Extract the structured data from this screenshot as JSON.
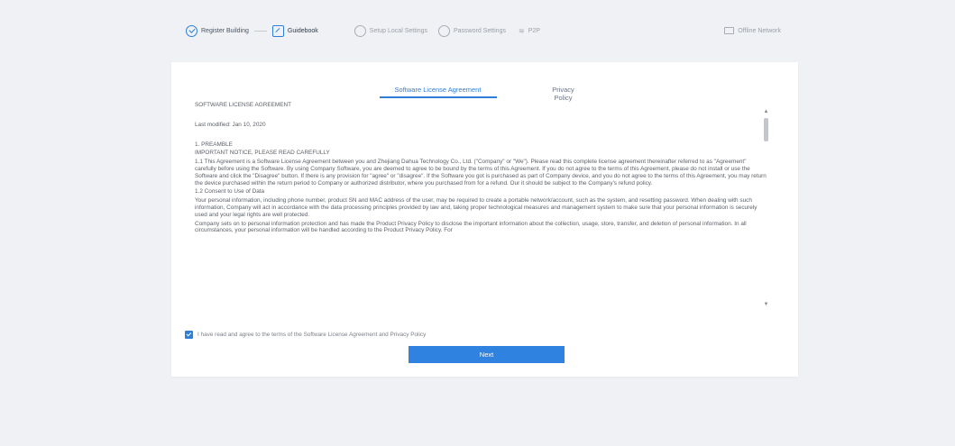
{
  "steps": [
    {
      "label": "Register Building",
      "state": "done",
      "icon": "check-circle-icon"
    },
    {
      "label": "Guidebook",
      "state": "active",
      "icon": "edit-icon"
    },
    {
      "label": "Setup Local Settings",
      "state": "pending",
      "icon": "circle-icon"
    },
    {
      "label": "Password Settings",
      "state": "pending",
      "icon": "circle-icon"
    },
    {
      "label": "P2P",
      "state": "pending",
      "icon": "wifi-icon"
    },
    {
      "label": "Offline Network",
      "state": "pending",
      "icon": "offline-icon"
    }
  ],
  "tabs": {
    "license": "Software License Agreement",
    "privacy": "Privacy Policy"
  },
  "document": {
    "title": "SOFTWARE LICENSE AGREEMENT",
    "modified": "Last modified: Jan 10, 2020",
    "section1": "1. PREAMBLE",
    "notice": "IMPORTANT NOTICE, PLEASE READ CAREFULLY",
    "p1": "1.1 This Agreement is a Software License Agreement between you and Zhejiang Dahua Technology Co., Ltd. (\"Company\" or \"We\"). Please read this complete license agreement thereinafter referred to as \"Agreement\" carefully before using the Software. By using Company Software, you are deemed to agree to be bound by the terms of this Agreement. If you do not agree to the terms of this Agreement, please do not install or use the Software and click the \"Disagree\" button. If there is any provision for \"agree\" or \"disagree\". If the Software you got is purchased as part of Company device, and you do not agree to the terms of this Agreement, you may return the device purchased within the return period to Company or authorized distributor, where you purchased from for a refund. Our it should be subject to the Company's refund policy.",
    "p2title": "1.2 Consent to Use of Data",
    "p2": "Your personal information, including phone number, product SN and MAC address of the user, may be required to create a portable network/account, such as the system, and resetting password. When dealing with such information, Company will act in accordance with the data processing principles provided by law and, taking proper technological measures and management system to make sure that your personal information is securely used and your legal rights are well protected.",
    "p3": "Company sets on to personal information protection and has made the Product Privacy Policy to disclose the important information about the collection, usage, store, transfer, and deletion of personal information. In all circumstances, your personal information will be handled according to the Product Privacy Policy. For"
  },
  "agreement": {
    "checked": true,
    "label": "I have read and agree to the terms of the Software License Agreement and Privacy Policy"
  },
  "buttons": {
    "next": "Next"
  },
  "colors": {
    "accent": "#2f7ed8",
    "page_bg": "#f0f1f4",
    "card_bg": "#ffffff"
  }
}
